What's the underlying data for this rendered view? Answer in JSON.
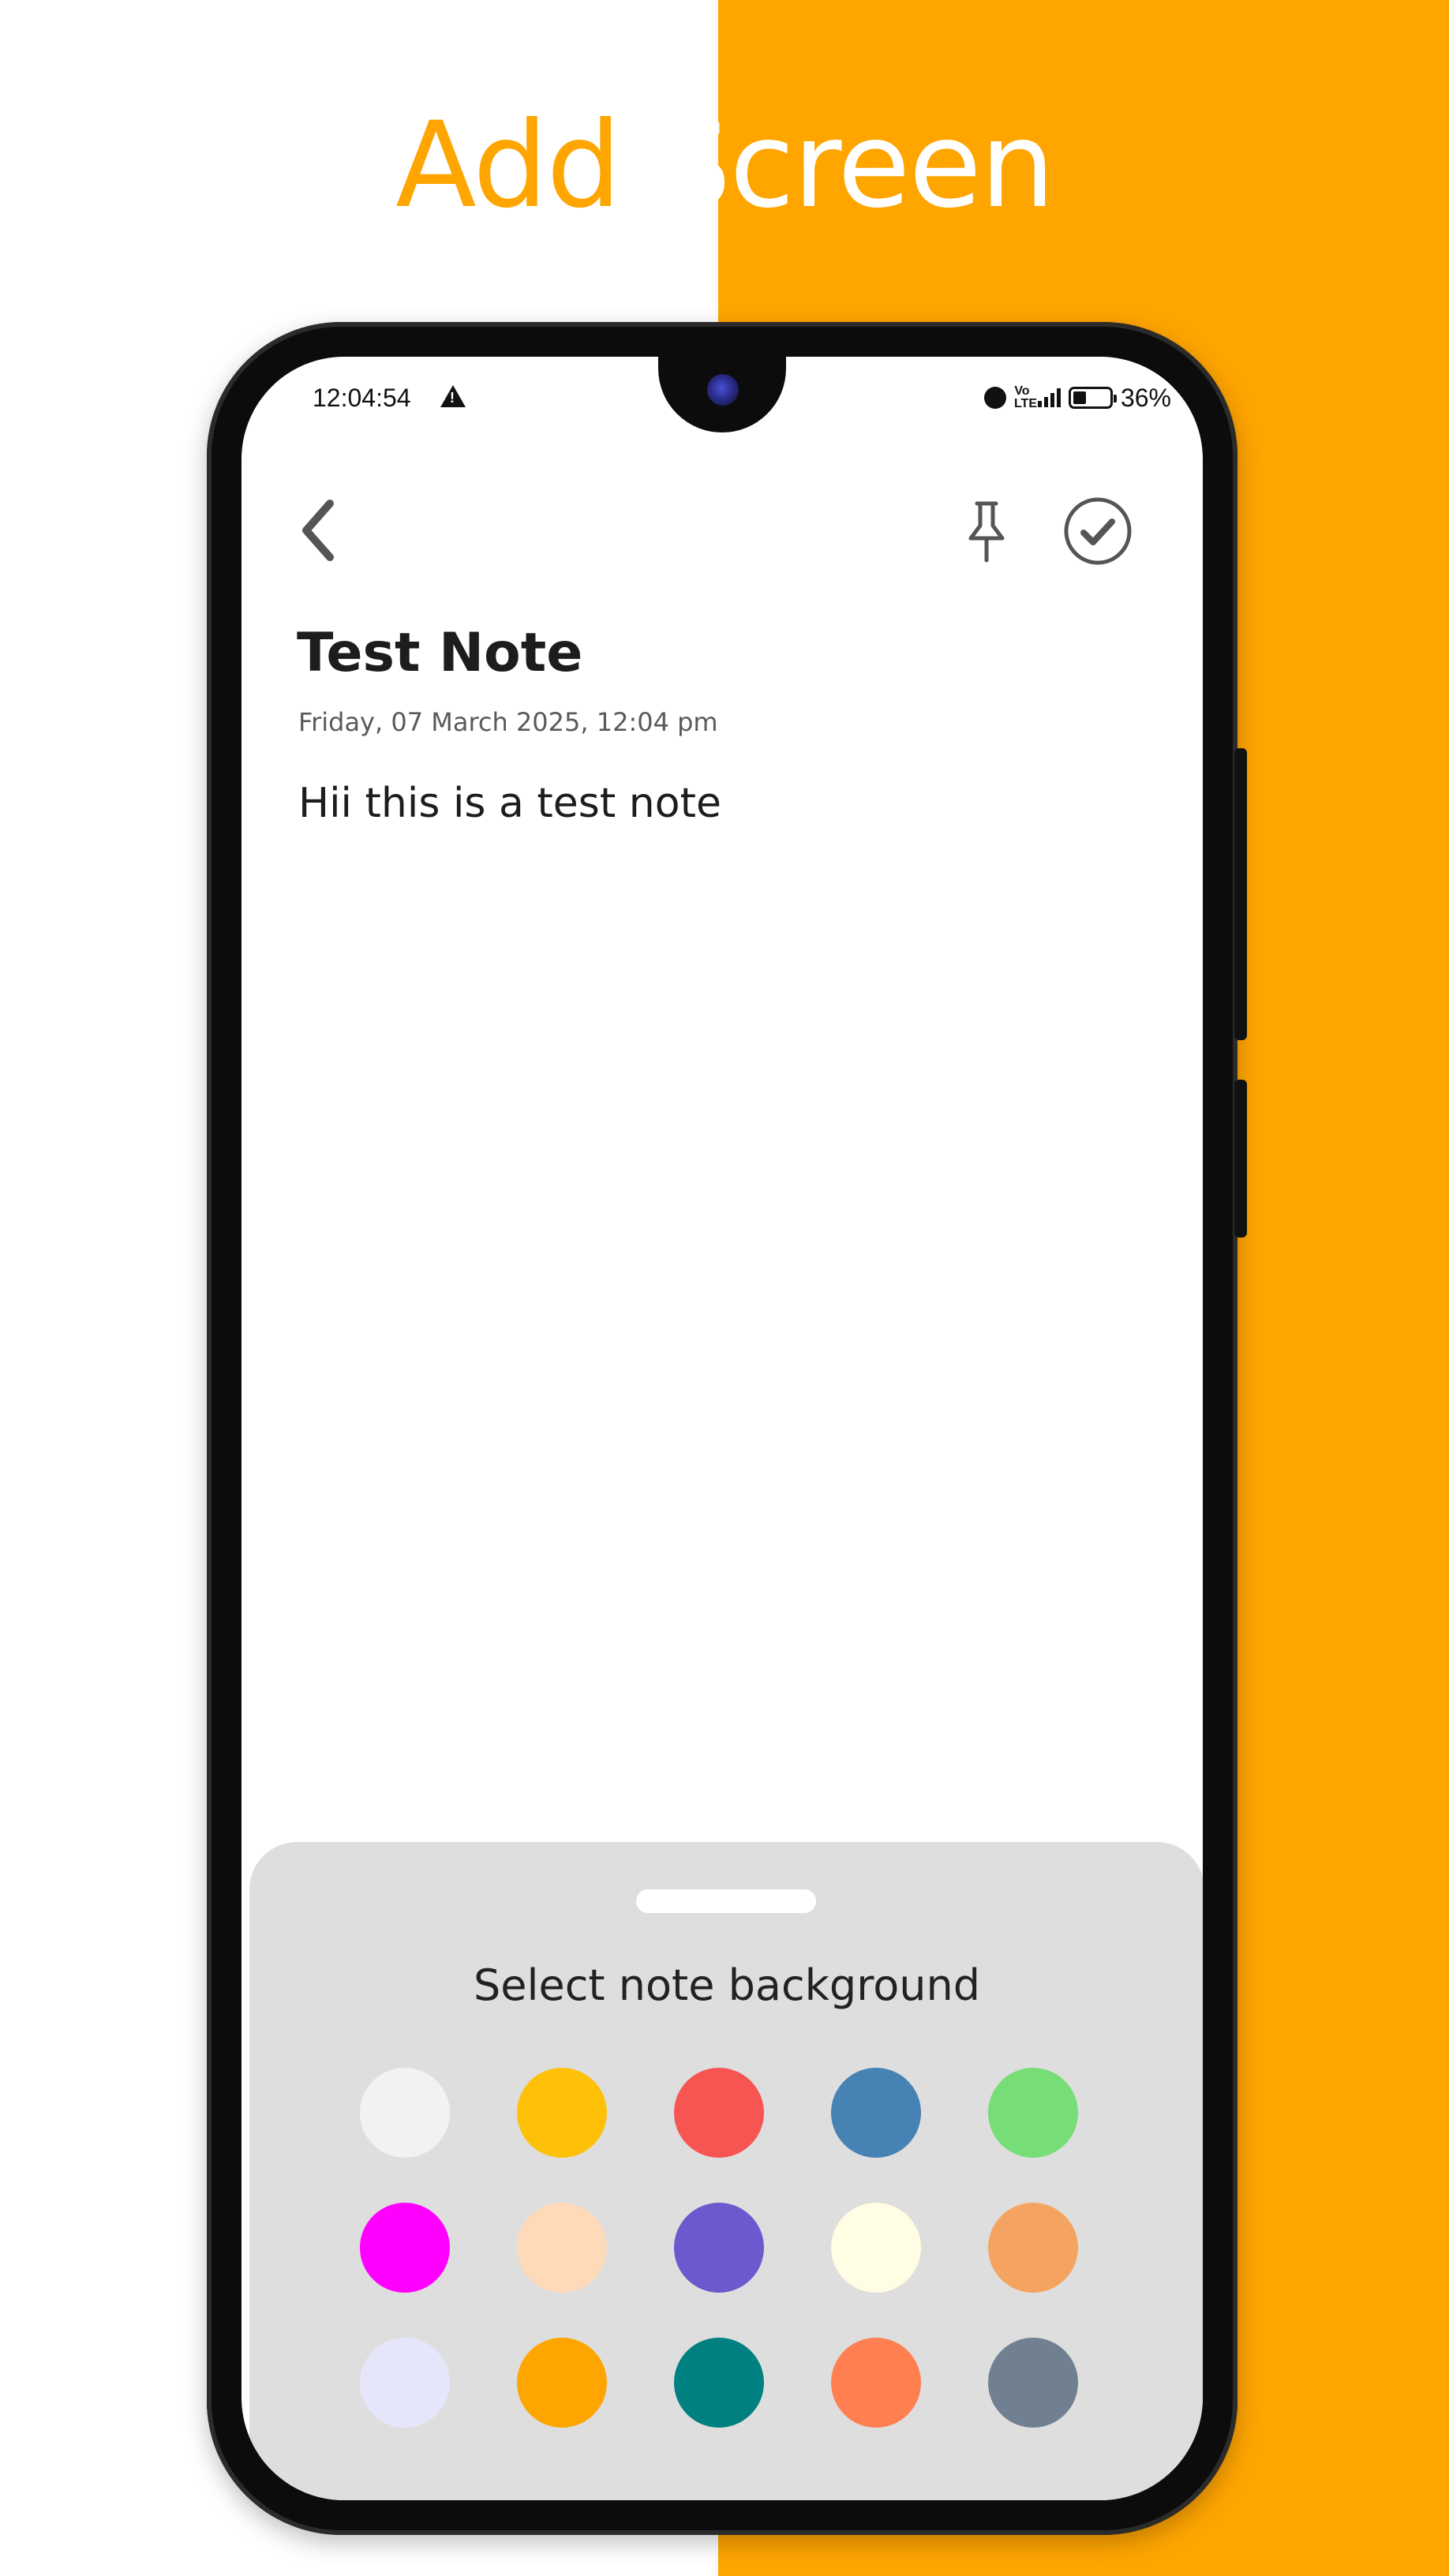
{
  "promo": {
    "title_word1": "Add",
    "title_word2": "Screen",
    "accent_color": "#FFA500"
  },
  "status_bar": {
    "time": "12:04:54",
    "warning_icon": "warning-icon",
    "alarm_icon": "alarm-icon",
    "volte_label": "Vo LTE",
    "signal_icon": "signal-icon",
    "battery_percent_text": "36%",
    "battery_level": 0.36
  },
  "app_bar": {
    "back_icon": "chevron-left-icon",
    "pin_icon": "pin-icon",
    "save_icon": "check-circle-icon"
  },
  "note": {
    "title": "Test Note",
    "date": "Friday, 07 March 2025, 12:04 pm",
    "body": "Hii this is a test note"
  },
  "bottom_sheet": {
    "title": "Select note background",
    "colors": [
      "#F2F2F2",
      "#FFC107",
      "#F65552",
      "#4682B4",
      "#77DD77",
      "#FF00FF",
      "#FFDAB9",
      "#6A5ACD",
      "#FFFDE3",
      "#F4A460",
      "#E6E6FA",
      "#FFA500",
      "#008080",
      "#FF7F50",
      "#708090"
    ]
  }
}
